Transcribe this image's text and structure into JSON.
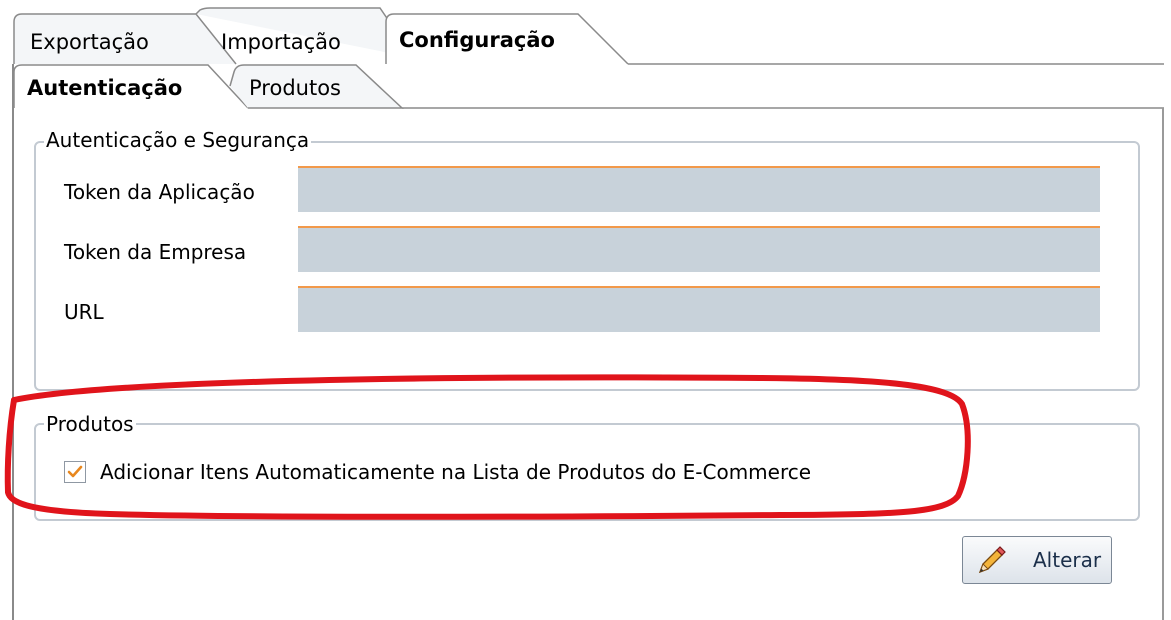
{
  "tabs_top": [
    {
      "label": "Exportação",
      "active": false
    },
    {
      "label": "Importação",
      "active": false
    },
    {
      "label": "Configuração",
      "active": true
    }
  ],
  "tabs_sub": [
    {
      "label": "Autenticação",
      "active": true
    },
    {
      "label": "Produtos",
      "active": false
    }
  ],
  "auth_group": {
    "legend": "Autenticação e Segurança",
    "fields": [
      {
        "label": "Token da Aplicação",
        "value": ""
      },
      {
        "label": "Token da Empresa",
        "value": ""
      },
      {
        "label": "URL",
        "value": ""
      }
    ]
  },
  "products_group": {
    "legend": "Produtos",
    "auto_add_checkbox": {
      "label": "Adicionar Itens Automaticamente na Lista de Produtos do E-Commerce",
      "checked": true
    }
  },
  "actions": {
    "alter_label": "Alterar",
    "alter_icon": "pencil-icon"
  },
  "colors": {
    "input_bg": "#c8d2da",
    "input_accent": "#f2994a",
    "group_border": "#c3cad2",
    "highlight_annotation": "#e0141b",
    "check_mark": "#e8871e"
  }
}
